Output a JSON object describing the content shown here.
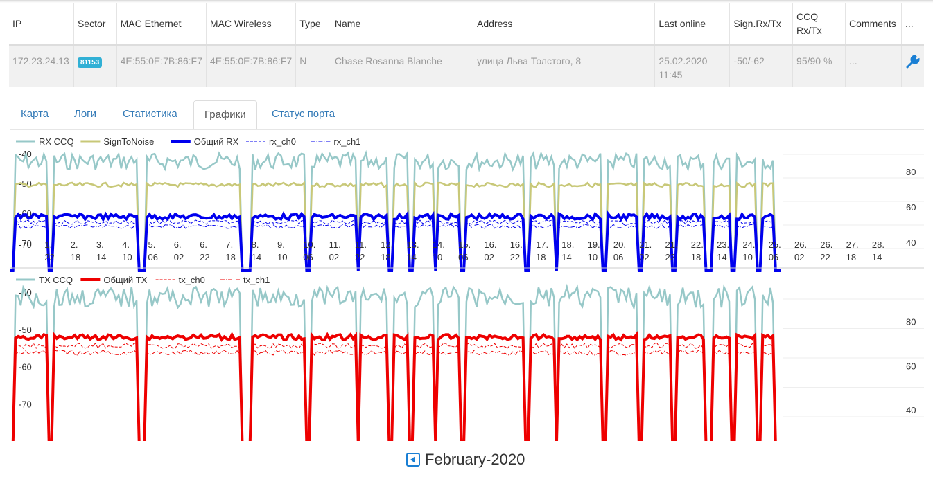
{
  "table": {
    "headers": [
      "IP",
      "Sector",
      "MAC Ethernet",
      "MAC Wireless",
      "Type",
      "Name",
      "Address",
      "Last online",
      "Sign.Rx/Tx",
      "CCQ Rx/Tx",
      "Comments",
      "..."
    ],
    "row": {
      "ip": "172.23.24.13",
      "sector": "81153",
      "mac_ethernet": "4E:55:0E:7B:86:F7",
      "mac_wireless": "4E:55:0E:7B:86:F7",
      "type": "N",
      "name": "Chase Rosanna Blanche",
      "address": "улица Льва Толстого, 8",
      "last_online": "25.02.2020 11:45",
      "sign_rx_tx": "-50/-62",
      "ccq_rx_tx": "95/90 %",
      "comments": "..."
    }
  },
  "tabs": [
    "Карта",
    "Логи",
    "Статистика",
    "Графики",
    "Статус порта"
  ],
  "active_tab": "Графики",
  "colors": {
    "ccq": "#97c8c8",
    "snr": "#c8c878",
    "rx": "#0000ee",
    "tx": "#ee0000",
    "link": "#337ab7",
    "badge": "#31b0d5"
  },
  "chart_data": [
    {
      "type": "line",
      "legend": [
        {
          "name": "RX CCQ",
          "style": "solid",
          "color": "#97c8c8"
        },
        {
          "name": "SignToNoise",
          "style": "solid",
          "color": "#c8c878"
        },
        {
          "name": "Общий RX",
          "style": "solid-bold",
          "color": "#0000ee"
        },
        {
          "name": "rx_ch0",
          "style": "dashed",
          "color": "#0000ee"
        },
        {
          "name": "rx_ch1",
          "style": "dashdot",
          "color": "#0000ee"
        }
      ],
      "left_ticks": [
        "-40",
        "-50",
        "-60",
        "-70"
      ],
      "right_ticks": [
        "80",
        "60",
        "40"
      ],
      "x_ticks": [
        [
          "-70",
          ""
        ],
        [
          "1.",
          "22"
        ],
        [
          "2.",
          "18"
        ],
        [
          "3.",
          "14"
        ],
        [
          "4.",
          "10"
        ],
        [
          "5.",
          "06"
        ],
        [
          "6.",
          "02"
        ],
        [
          "6.",
          "22"
        ],
        [
          "7.",
          "18"
        ],
        [
          "8.",
          "14"
        ],
        [
          "9.",
          "10"
        ],
        [
          "10.",
          "06"
        ],
        [
          "11.",
          "02"
        ],
        [
          "11.",
          "22"
        ],
        [
          "12.",
          "18"
        ],
        [
          "13.",
          "14"
        ],
        [
          "14.",
          "10"
        ],
        [
          "15.",
          "06"
        ],
        [
          "16.",
          "02"
        ],
        [
          "16.",
          "22"
        ],
        [
          "17.",
          "18"
        ],
        [
          "18.",
          "14"
        ],
        [
          "19.",
          "10"
        ],
        [
          "20.",
          "06"
        ],
        [
          "21.",
          "02"
        ],
        [
          "21.",
          "22"
        ],
        [
          "22.",
          "18"
        ],
        [
          "23.",
          "14"
        ],
        [
          "24.",
          "10"
        ],
        [
          "25.",
          "06"
        ],
        [
          "26.",
          "02"
        ],
        [
          "26.",
          "22"
        ],
        [
          "27.",
          "18"
        ],
        [
          "28.",
          "14"
        ]
      ],
      "series": [
        {
          "name": "RX CCQ",
          "level": 93
        },
        {
          "name": "SignToNoise",
          "level": -50
        },
        {
          "name": "Общий RX",
          "level": -61
        },
        {
          "name": "rx_ch0",
          "level": -63
        },
        {
          "name": "rx_ch1",
          "level": -64
        }
      ]
    },
    {
      "type": "line",
      "legend": [
        {
          "name": "TX CCQ",
          "style": "solid",
          "color": "#97c8c8"
        },
        {
          "name": "Общий TX",
          "style": "solid-bold",
          "color": "#ee0000"
        },
        {
          "name": "tx_ch0",
          "style": "dashed",
          "color": "#ee0000"
        },
        {
          "name": "tx_ch1",
          "style": "dashdot",
          "color": "#ee0000"
        }
      ],
      "left_ticks": [
        "-40",
        "-50",
        "-60",
        "-70"
      ],
      "right_ticks": [
        "80",
        "60",
        "40"
      ],
      "series": [
        {
          "name": "TX CCQ",
          "level": 93
        },
        {
          "name": "Общий TX",
          "level": -50
        },
        {
          "name": "tx_ch0",
          "level": -52
        },
        {
          "name": "tx_ch1",
          "level": -54
        }
      ]
    }
  ],
  "footer": {
    "month": "February-2020"
  }
}
